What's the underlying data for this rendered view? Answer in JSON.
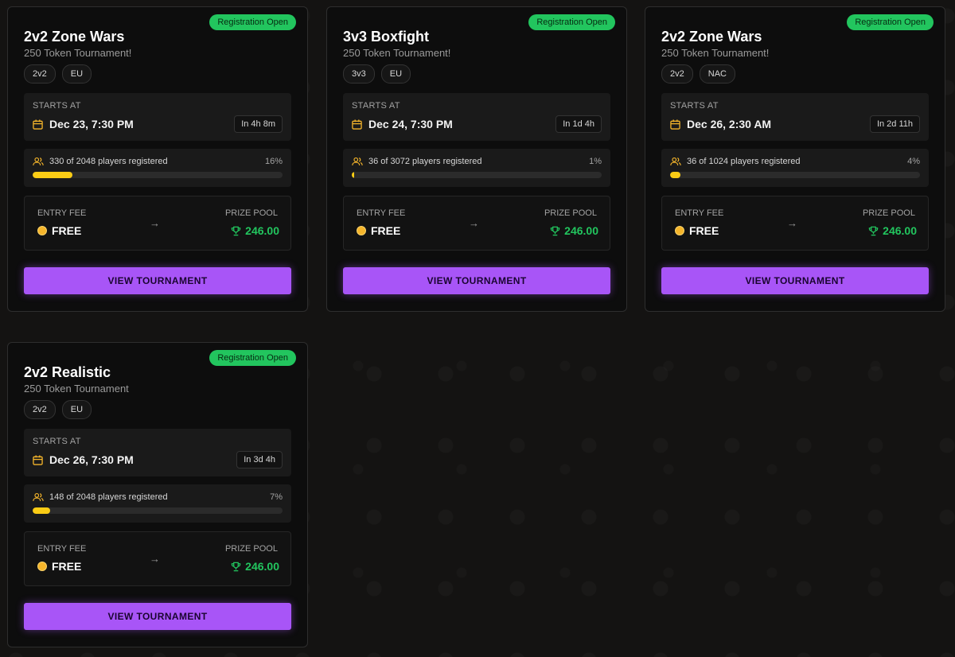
{
  "cards": [
    {
      "badge": "Registration Open",
      "title": "2v2 Zone Wars",
      "subtitle": "250 Token Tournament!",
      "tags": [
        "2v2",
        "EU"
      ],
      "starts_label": "STARTS AT",
      "starts_at": "Dec 23, 7:30 PM",
      "countdown": "In 4h 8m",
      "players_text": "330 of 2048 players registered",
      "players_pct": "16%",
      "fill_percent": 16,
      "entry_label": "ENTRY FEE",
      "entry_value": "FREE",
      "prize_label": "PRIZE POOL",
      "prize_value": "246.00",
      "button": "VIEW TOURNAMENT"
    },
    {
      "badge": "Registration Open",
      "title": "3v3 Boxfight",
      "subtitle": "250 Token Tournament!",
      "tags": [
        "3v3",
        "EU"
      ],
      "starts_label": "STARTS AT",
      "starts_at": "Dec 24, 7:30 PM",
      "countdown": "In 1d 4h",
      "players_text": "36 of 3072 players registered",
      "players_pct": "1%",
      "fill_percent": 1,
      "entry_label": "ENTRY FEE",
      "entry_value": "FREE",
      "prize_label": "PRIZE POOL",
      "prize_value": "246.00",
      "button": "VIEW TOURNAMENT"
    },
    {
      "badge": "Registration Open",
      "title": "2v2 Zone Wars",
      "subtitle": "250 Token Tournament!",
      "tags": [
        "2v2",
        "NAC"
      ],
      "starts_label": "STARTS AT",
      "starts_at": "Dec 26, 2:30 AM",
      "countdown": "In 2d 11h",
      "players_text": "36 of 1024 players registered",
      "players_pct": "4%",
      "fill_percent": 4,
      "entry_label": "ENTRY FEE",
      "entry_value": "FREE",
      "prize_label": "PRIZE POOL",
      "prize_value": "246.00",
      "button": "VIEW TOURNAMENT"
    },
    {
      "badge": "Registration Open",
      "title": "2v2 Realistic",
      "subtitle": "250 Token Tournament",
      "tags": [
        "2v2",
        "EU"
      ],
      "starts_label": "STARTS AT",
      "starts_at": "Dec 26, 7:30 PM",
      "countdown": "In 3d 4h",
      "players_text": "148 of 2048 players registered",
      "players_pct": "7%",
      "fill_percent": 7,
      "entry_label": "ENTRY FEE",
      "entry_value": "FREE",
      "prize_label": "PRIZE POOL",
      "prize_value": "246.00",
      "button": "VIEW TOURNAMENT"
    }
  ],
  "colors": {
    "badge": "#22c55e",
    "button": "#a855f7",
    "progress": "#facc15",
    "prize": "#22c55e",
    "coin": "#f5b52b"
  }
}
